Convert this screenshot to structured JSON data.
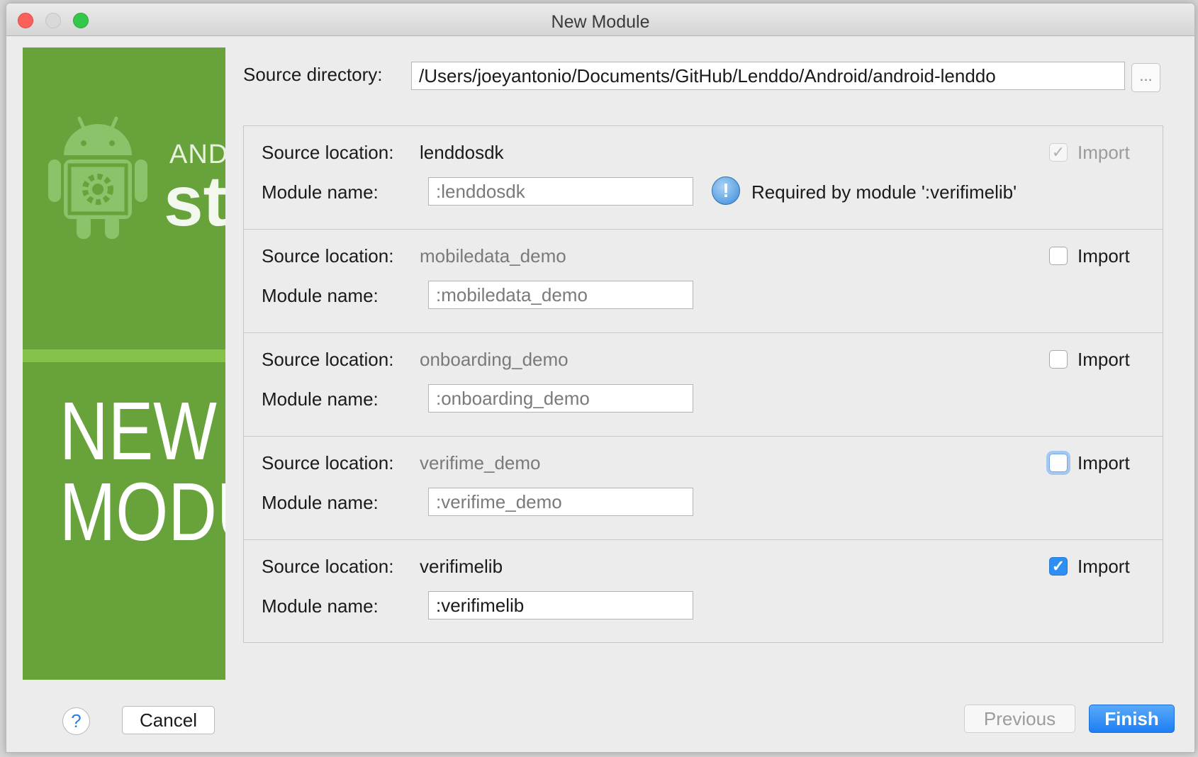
{
  "window": {
    "title": "New Module"
  },
  "banner": {
    "brand_small": "ANDROID",
    "brand_big": "studio",
    "hero": "NEW\nMODULE"
  },
  "source_directory": {
    "label": "Source directory:",
    "value": "/Users/joeyantonio/Documents/GitHub/Lenddo/Android/android-lenddo",
    "browse_label": "..."
  },
  "labels": {
    "source_location": "Source location:",
    "module_name": "Module name:",
    "import": "Import"
  },
  "modules": [
    {
      "source_location": "lenddosdk",
      "module_name": ":lenddosdk",
      "import_checked": true,
      "import_enabled": false,
      "note": "Required by module ':verifimelib'"
    },
    {
      "source_location": "mobiledata_demo",
      "module_name": ":mobiledata_demo",
      "import_checked": false,
      "import_enabled": true
    },
    {
      "source_location": "onboarding_demo",
      "module_name": ":onboarding_demo",
      "import_checked": false,
      "import_enabled": true
    },
    {
      "source_location": "verifime_demo",
      "module_name": ":verifime_demo",
      "import_checked": false,
      "import_enabled": true,
      "focused": true
    },
    {
      "source_location": "verifimelib",
      "module_name": ":verifimelib",
      "import_checked": true,
      "import_enabled": true
    }
  ],
  "buttons": {
    "help": "?",
    "cancel": "Cancel",
    "previous": "Previous",
    "finish": "Finish"
  },
  "colors": {
    "banner_green": "#67a23a",
    "accent_blue": "#2e8ef2"
  }
}
